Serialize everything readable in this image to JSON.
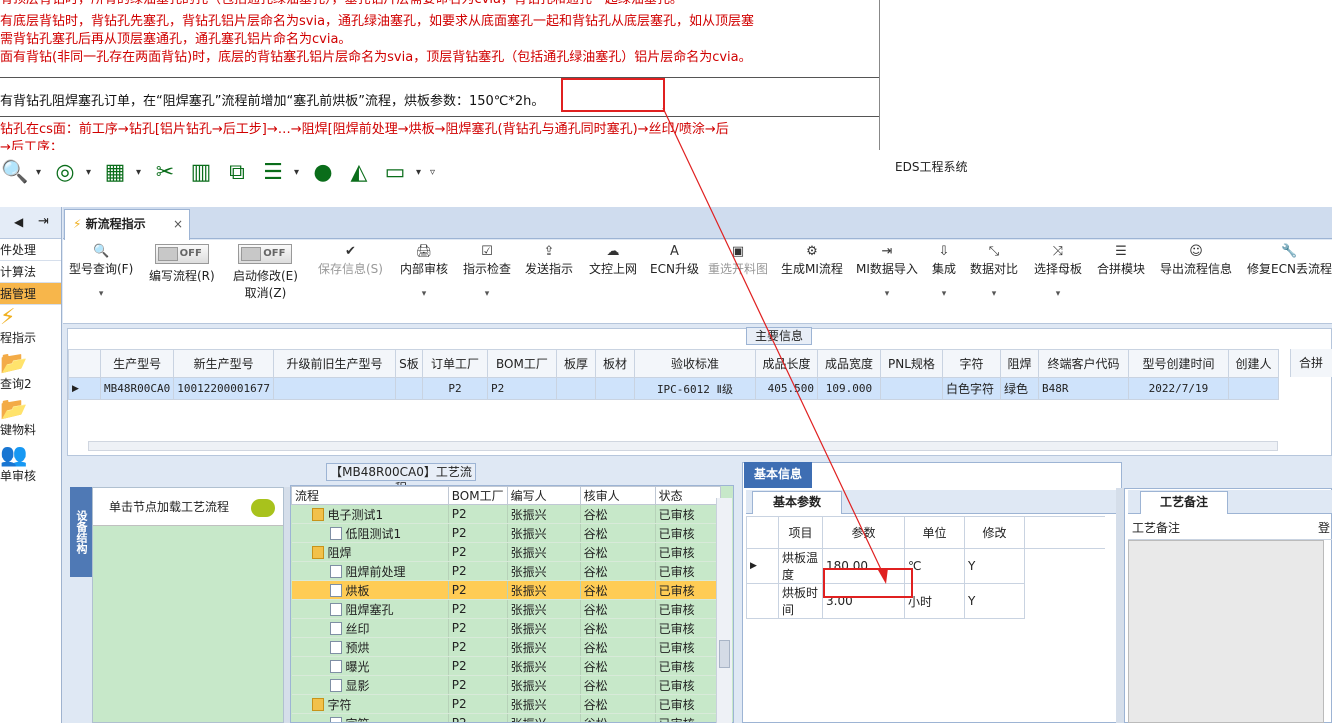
{
  "doc": {
    "red_lines": [
      "有顶层背钻时，所有的绿油塞孔的孔（包括通孔绿油塞孔），塞孔铝片层需要命名为cvia，背钻孔和通孔一起绿油塞孔。",
      "有底层背钻时，背钻孔先塞孔，背钻孔铝片层命名为svia，通孔绿油塞孔，如要求从底面塞孔一起和背钻孔从底层塞孔，如从顶层塞",
      "需背钻孔塞孔后再从顶层塞通孔，通孔塞孔铝片命名为cvia。",
      "面有背钻(非同一孔存在两面背钻)时，底层的背钻塞孔铝片层命名为svia，顶层背钻塞孔（包括通孔绿油塞孔）铝片层命名为cvia。"
    ],
    "black_line": "有背钻孔阻焊塞孔订单，在“阻焊塞孔”流程前增加“塞孔前烘板”流程，烘板参数：",
    "black_highlight": "150℃*2h。",
    "red_bottom": [
      "钻孔在cs面：前工序→钻孔[铝片钻孔→后工步]→…→阻焊[阻焊前处理→烘板→阻焊塞孔(背钻孔与通孔同时塞孔)→丝印/喷涂→后",
      "→后工序；"
    ]
  },
  "quick_toolbar": {
    "icons": [
      "search-icon",
      "lifebuoy-icon",
      "grid-icon",
      "scissors-icon",
      "film-icon",
      "copy-icon",
      "list-icon",
      "user-icon",
      "area-chart-icon",
      "monitor-icon"
    ]
  },
  "app_title": "EDS工程系统",
  "sidebar": {
    "items": [
      {
        "label": "件处理",
        "selected": false
      },
      {
        "label": "计算法",
        "selected": false
      },
      {
        "label": "据管理",
        "selected": true
      }
    ],
    "big_items": [
      "程指示",
      "查询2",
      "键物料",
      "单审核"
    ]
  },
  "tab": {
    "label": "新流程指示",
    "close": "×"
  },
  "ribbon": {
    "buttons": [
      {
        "label": "型号查询(F)",
        "icon": "🔍"
      },
      {
        "label": "编写流程(R)",
        "toggle": "OFF"
      },
      {
        "label": "启动修改(E)",
        "sub": "取消(Z)",
        "toggle": "OFF"
      },
      {
        "label": "保存信息(S)",
        "icon": "✔"
      },
      {
        "label": "内部审核",
        "icon": "🖨"
      },
      {
        "label": "指示检查",
        "icon": "☑"
      },
      {
        "label": "发送指示",
        "icon": "⇪"
      },
      {
        "label": "文控上网",
        "icon": "☁"
      },
      {
        "label": "ECN升级",
        "icon": "A"
      },
      {
        "label": "重选开料图",
        "icon": "▣"
      },
      {
        "label": "生成MI流程",
        "icon": "⚙"
      },
      {
        "label": "MI数据导入",
        "icon": "⇥"
      },
      {
        "label": "集成",
        "icon": "⇩"
      },
      {
        "label": "数据对比",
        "icon": "⤡"
      },
      {
        "label": "选择母板",
        "icon": "⤨"
      },
      {
        "label": "合拼模块",
        "icon": "☰"
      },
      {
        "label": "导出流程信息",
        "icon": "☺"
      },
      {
        "label": "修复ECN丢流程",
        "icon": "🔧"
      }
    ]
  },
  "main_info": {
    "title": "主要信息",
    "columns": [
      "生产型号",
      "新生产型号",
      "升级前旧生产型号",
      "S板",
      "订单工厂",
      "BOM工厂",
      "板厚",
      "板材",
      "验收标准",
      "成品长度",
      "成品宽度",
      "PNL规格",
      "字符",
      "阻焊",
      "终端客户代码",
      "型号创建时间",
      "创建人"
    ],
    "row": [
      "MB48R00CA0",
      "10012200001677",
      "",
      "",
      "P2",
      "P2",
      "",
      "",
      "IPC-6012 Ⅱ级",
      "405.500",
      "109.000",
      "",
      "白色字符",
      "绿色",
      "B48R",
      "2022/7/19",
      ""
    ],
    "right_header": "合拼"
  },
  "flow_panel": {
    "title": "【MB48R00CA0】工艺流程",
    "vtab": "设备结构",
    "load_label": "单击节点加载工艺流程",
    "columns": [
      "流程",
      "BOM工厂",
      "编写人",
      "核审人",
      "状态"
    ],
    "rows": [
      {
        "name": "电子测试1",
        "level": 1,
        "type": "folder",
        "bom": "P2",
        "writer": "张振兴",
        "checker": "谷松",
        "status": "已审核",
        "sel": false
      },
      {
        "name": "低阻测试1",
        "level": 2,
        "type": "file",
        "bom": "P2",
        "writer": "张振兴",
        "checker": "谷松",
        "status": "已审核",
        "sel": false
      },
      {
        "name": "阻焊",
        "level": 1,
        "type": "folder",
        "bom": "P2",
        "writer": "张振兴",
        "checker": "谷松",
        "status": "已审核",
        "sel": false
      },
      {
        "name": "阻焊前处理",
        "level": 2,
        "type": "file",
        "bom": "P2",
        "writer": "张振兴",
        "checker": "谷松",
        "status": "已审核",
        "sel": false
      },
      {
        "name": "烘板",
        "level": 2,
        "type": "file",
        "bom": "P2",
        "writer": "张振兴",
        "checker": "谷松",
        "status": "已审核",
        "sel": true
      },
      {
        "name": "阻焊塞孔",
        "level": 2,
        "type": "file",
        "bom": "P2",
        "writer": "张振兴",
        "checker": "谷松",
        "status": "已审核",
        "sel": false
      },
      {
        "name": "丝印",
        "level": 2,
        "type": "file",
        "bom": "P2",
        "writer": "张振兴",
        "checker": "谷松",
        "status": "已审核",
        "sel": false
      },
      {
        "name": "预烘",
        "level": 2,
        "type": "file",
        "bom": "P2",
        "writer": "张振兴",
        "checker": "谷松",
        "status": "已审核",
        "sel": false
      },
      {
        "name": "曝光",
        "level": 2,
        "type": "file",
        "bom": "P2",
        "writer": "张振兴",
        "checker": "谷松",
        "status": "已审核",
        "sel": false
      },
      {
        "name": "显影",
        "level": 2,
        "type": "file",
        "bom": "P2",
        "writer": "张振兴",
        "checker": "谷松",
        "status": "已审核",
        "sel": false
      },
      {
        "name": "字符",
        "level": 1,
        "type": "folder",
        "bom": "P2",
        "writer": "张振兴",
        "checker": "谷松",
        "status": "已审核",
        "sel": false
      },
      {
        "name": "字符",
        "level": 2,
        "type": "file",
        "bom": "P2",
        "writer": "张振兴",
        "checker": "谷松",
        "status": "已审核",
        "sel": false
      }
    ]
  },
  "basic_info": {
    "tab": "基本信息",
    "subtab": "基本参数",
    "columns": [
      "项目",
      "参数",
      "单位",
      "修改"
    ],
    "rows": [
      {
        "item": "烘板温度",
        "param": "180.00",
        "unit": "℃",
        "modify": "Y"
      },
      {
        "item": "烘板时间",
        "param": "3.00",
        "unit": "小时",
        "modify": "Y"
      }
    ]
  },
  "remark": {
    "subtab": "工艺备注",
    "header": "工艺备注",
    "extra": "登"
  },
  "colors": {
    "accent": "#3e6eb3",
    "selection": "#f7b64b",
    "annotation": "#e02020",
    "tree_bg": "#c7e8c9"
  }
}
